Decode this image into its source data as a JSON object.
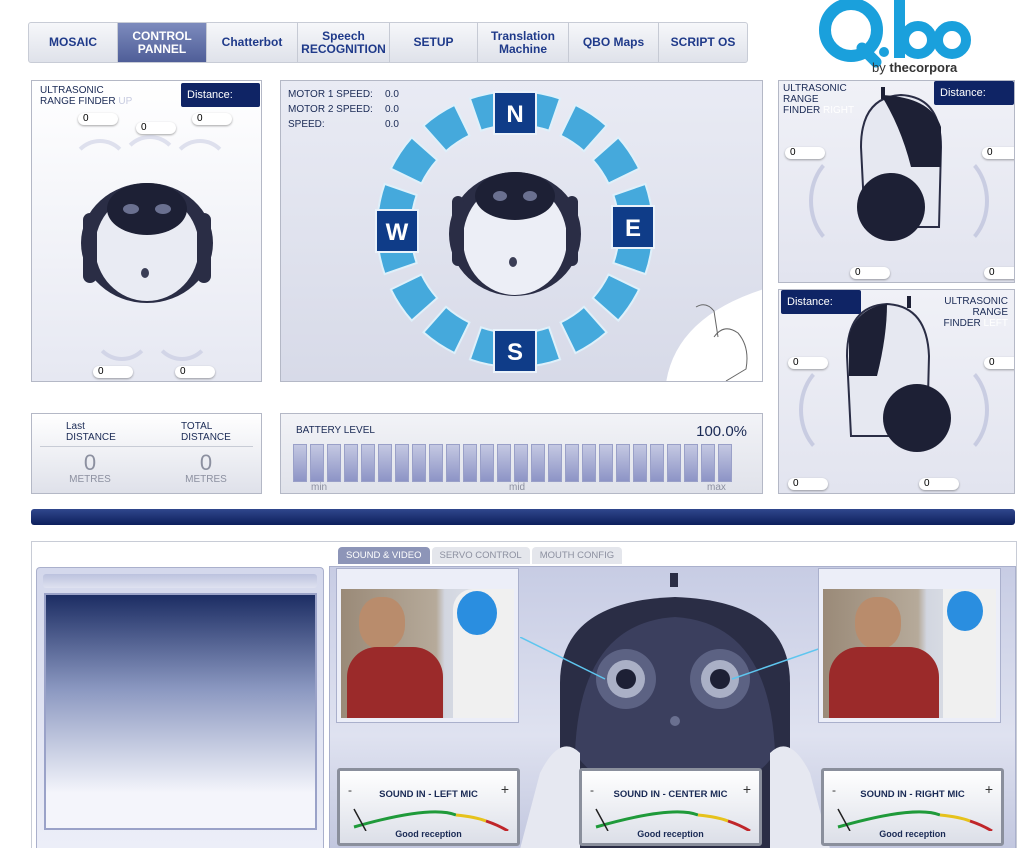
{
  "nav": {
    "tabs": [
      {
        "label": "MOSAIC",
        "active": false
      },
      {
        "label": "CONTROL\nPANNEL",
        "active": true
      },
      {
        "label": "Chatterbot",
        "active": false
      },
      {
        "label": "Speech\nRECOGNITION",
        "active": false
      },
      {
        "label": "SETUP",
        "active": false
      },
      {
        "label": "Translation\nMachine",
        "active": false
      },
      {
        "label": "QBO Maps",
        "active": false
      },
      {
        "label": "SCRIPT OS",
        "active": false
      }
    ]
  },
  "logo": {
    "text": "Q.bo",
    "by": "by",
    "brand": "thecorpora"
  },
  "ultrasonic_up": {
    "label_line1": "ULTRASONIC",
    "label_line2": "RANGE FINDER",
    "direction": "UP",
    "distance_label": "Distance:",
    "readings": [
      "0",
      "0",
      "0",
      "0",
      "0"
    ]
  },
  "motor": {
    "motor1_label": "MOTOR 1 SPEED:",
    "motor1_value": "0.0",
    "motor2_label": "MOTOR 2 SPEED:",
    "motor2_value": "0.0",
    "speed_label": "SPEED:",
    "speed_value": "0.0",
    "compass": {
      "n": "N",
      "s": "S",
      "e": "E",
      "w": "W"
    }
  },
  "ultrasonic_right": {
    "label_line1": "ULTRASONIC",
    "label_line2": "RANGE",
    "label_line3": "FINDER",
    "direction": "RIGHT",
    "distance_label": "Distance:",
    "readings": [
      "0",
      "0",
      "0",
      "0"
    ]
  },
  "ultrasonic_left": {
    "label_line1": "ULTRASONIC",
    "label_line2": "RANGE",
    "label_line3": "FINDER",
    "direction": "LEFT",
    "distance_label": "Distance:",
    "readings": [
      "0",
      "0",
      "0",
      "0"
    ]
  },
  "stats": {
    "last_label_1": "Last",
    "last_label_2": "DISTANCE",
    "last_value": "0",
    "last_unit": "METRES",
    "total_label_1": "TOTAL",
    "total_label_2": "DISTANCE",
    "total_value": "0",
    "total_unit": "METRES"
  },
  "battery": {
    "title": "BATTERY LEVEL",
    "percent_text": "100.0%",
    "level_fraction": 1.0,
    "min": "min",
    "mid": "mid",
    "max": "max"
  },
  "subtabs": [
    {
      "label": "SOUND & VIDEO",
      "active": true
    },
    {
      "label": "SERVO CONTROL",
      "active": false
    },
    {
      "label": "MOUTH CONFIG",
      "active": false
    }
  ],
  "meters": [
    {
      "title": "SOUND IN  - LEFT MIC",
      "status": "Good reception",
      "minus": "-",
      "plus": "+"
    },
    {
      "title": "SOUND IN  - CENTER MIC",
      "status": "Good reception",
      "minus": "-",
      "plus": "+"
    },
    {
      "title": "SOUND IN  - RIGHT MIC",
      "status": "Good reception",
      "minus": "-",
      "plus": "+"
    }
  ],
  "colors": {
    "nav_active": "#5d6ba3",
    "dark_navy": "#0f2465",
    "compass_blue": "#45a9dc",
    "logo_cyan": "#1aa0dc"
  }
}
